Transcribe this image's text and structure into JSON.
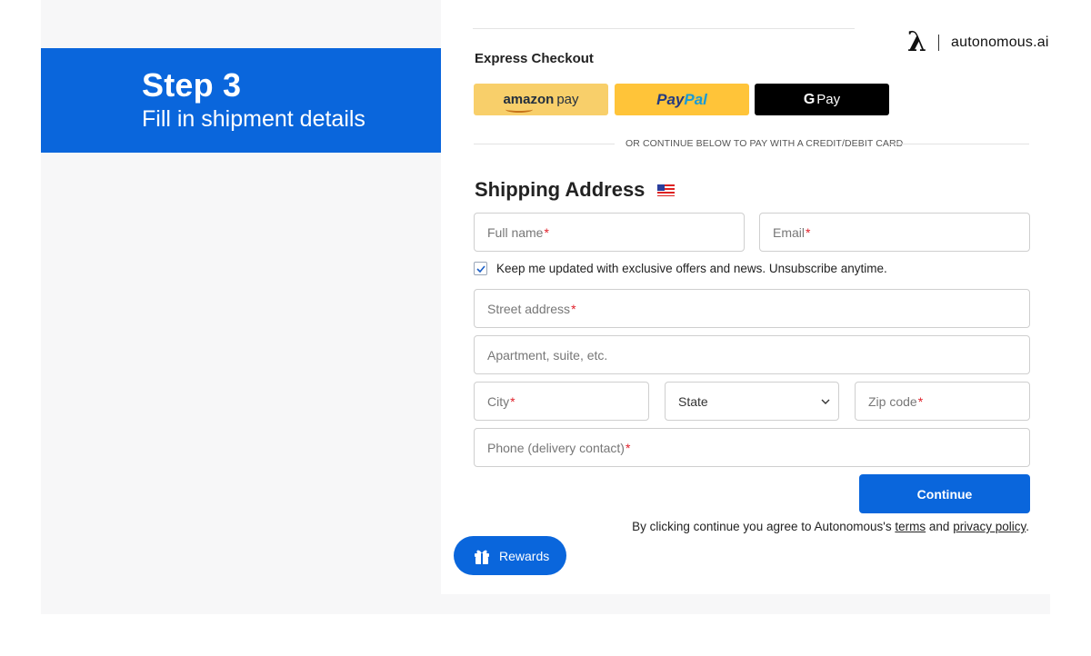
{
  "step_banner": {
    "title": "Step 3",
    "subtitle": "Fill in shipment details"
  },
  "brand": {
    "mark": "λ",
    "name": "autonomous.ai"
  },
  "express_checkout": {
    "title": "Express Checkout",
    "amazon_pay": {
      "word1": "amazon",
      "word2": "pay"
    },
    "paypal": {
      "word1": "Pay",
      "word2": "Pal"
    },
    "google_pay": {
      "g": "G",
      "label": "Pay"
    }
  },
  "divider_text": "OR CONTINUE BELOW TO PAY WITH A CREDIT/DEBIT CARD",
  "shipping": {
    "title": "Shipping Address",
    "full_name": {
      "placeholder": "Full name",
      "required": "*"
    },
    "email": {
      "placeholder": "Email",
      "required": "*"
    },
    "newsletter": {
      "label": "Keep me updated with exclusive offers and news. Unsubscribe anytime.",
      "checked": true
    },
    "street": {
      "placeholder": "Street address",
      "required": "*"
    },
    "apartment": {
      "placeholder": "Apartment, suite, etc."
    },
    "city": {
      "placeholder": "City",
      "required": "*"
    },
    "state": {
      "selected": "State"
    },
    "zip": {
      "placeholder": "Zip code",
      "required": "*"
    },
    "phone": {
      "placeholder": "Phone (delivery contact)",
      "required": "*"
    }
  },
  "continue_label": "Continue",
  "terms": {
    "prefix": "By clicking continue you agree to Autonomous's",
    "terms_link": "terms",
    "and": "and",
    "privacy_link": "privacy policy",
    "suffix": "."
  },
  "rewards_label": "Rewards",
  "colors": {
    "primary_blue": "#0a66dc",
    "amazon_pay_yellow": "#f8cf6a",
    "paypal_yellow": "#ffc439",
    "google_pay_black": "#000000",
    "required_red": "#e0202a"
  }
}
